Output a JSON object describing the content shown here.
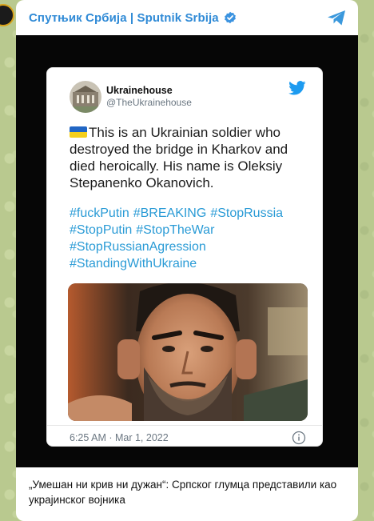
{
  "channel": {
    "name": "Спутњик Србија | Sputnik Srbija"
  },
  "tweet": {
    "display_name": "Ukrainehouse",
    "handle": "@TheUkrainehouse",
    "text": "This is an Ukrainian soldier who destroyed the bridge in Kharkov and died heroically. His name is Oleksiy Stepanenko Okanovich.",
    "hashtag_rows": [
      [
        "#fuckPutin",
        "#BREAKING",
        "#StopRussia"
      ],
      [
        "#StopPutin",
        "#StopTheWar"
      ],
      [
        "#StopRussianAgression"
      ],
      [
        "#StandingWithUkraine"
      ]
    ],
    "timestamp": "6:25 AM · Mar 1, 2022"
  },
  "post": {
    "caption": "„Умешан ни крив ни дужан“: Српског глумца представили као украјинског војника"
  },
  "colors": {
    "accent": "#2f8ad6",
    "hashtag": "#2a9bd6",
    "flag_blue": "#2166c4",
    "flag_yellow": "#f5cf1b"
  },
  "icons": {
    "verified": "verified-badge-icon",
    "share": "share-icon",
    "twitter": "twitter-bird-icon",
    "info": "info-icon",
    "flag": "ukraine-flag-icon"
  }
}
